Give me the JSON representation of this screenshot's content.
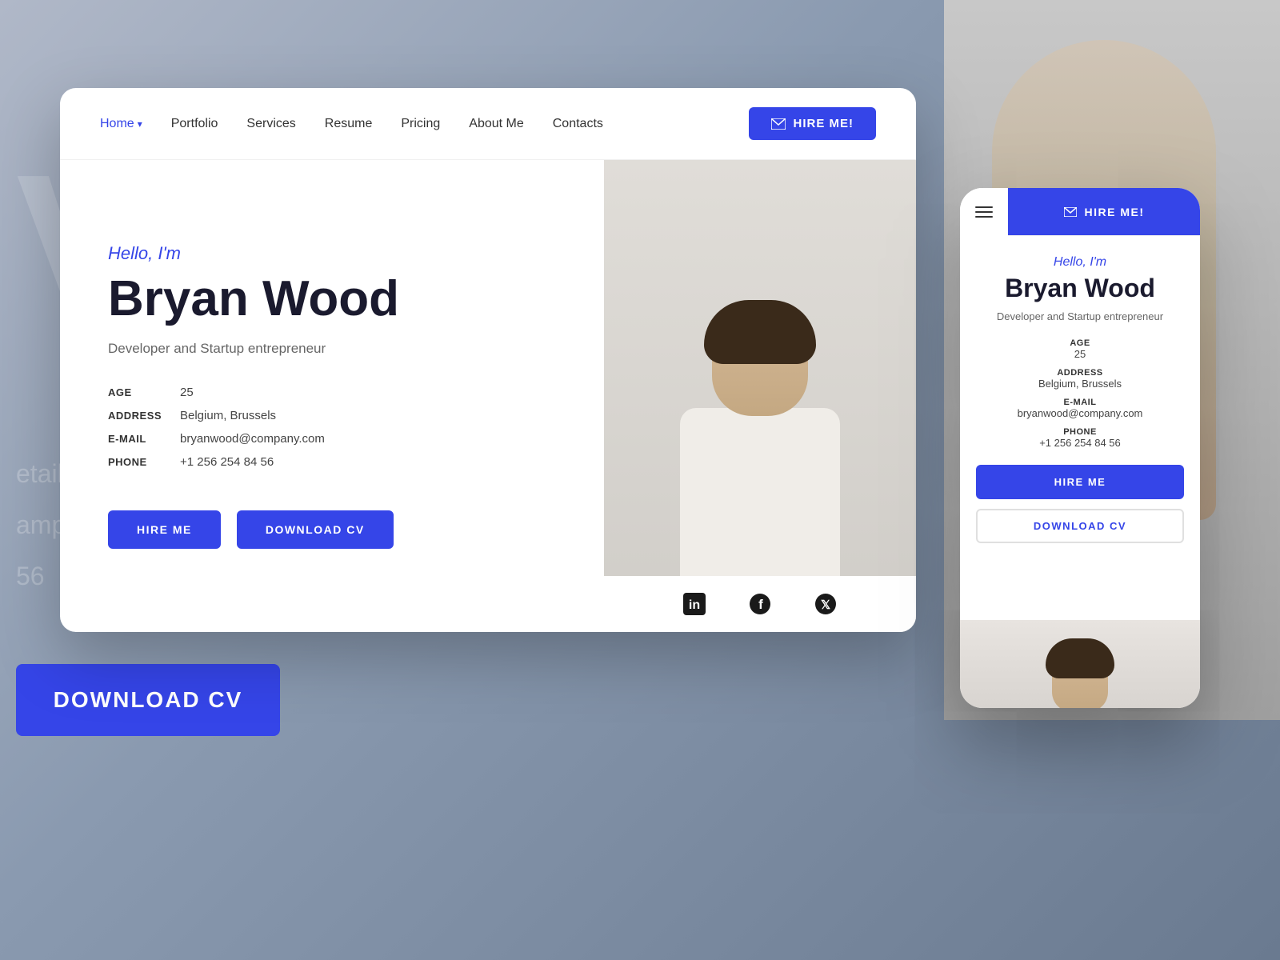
{
  "background": {
    "letter": "V",
    "lines": [
      "etails",
      "ampus",
      "56"
    ]
  },
  "nav": {
    "links": [
      {
        "label": "Home",
        "active": true
      },
      {
        "label": "Portfolio",
        "active": false
      },
      {
        "label": "Services",
        "active": false
      },
      {
        "label": "Resume",
        "active": false
      },
      {
        "label": "Pricing",
        "active": false
      },
      {
        "label": "About Me",
        "active": false
      },
      {
        "label": "Contacts",
        "active": false
      }
    ],
    "hire_button": "HIRE ME!"
  },
  "profile": {
    "greeting": "Hello, I'm",
    "name": "Bryan Wood",
    "subtitle": "Developer and Startup entrepreneur",
    "info": {
      "age_label": "AGE",
      "age_value": "25",
      "address_label": "ADDRESS",
      "address_value": "Belgium, Brussels",
      "email_label": "E-MAIL",
      "email_value": "bryanwood@company.com",
      "phone_label": "PHONE",
      "phone_value": "+1 256 254 84 56"
    },
    "hire_me_btn": "HIRE ME",
    "download_cv_btn": "DOWNLOAD CV"
  },
  "social": {
    "linkedin": "in",
    "facebook": "f",
    "twitter": "t"
  },
  "mobile": {
    "hire_button": "HIRE ME!",
    "greeting": "Hello, I'm",
    "name": "Bryan Wood",
    "subtitle": "Developer and Startup entrepreneur",
    "info": {
      "age_label": "AGE",
      "age_value": "25",
      "address_label": "ADDRESS",
      "address_value": "Belgium, Brussels",
      "email_label": "E-MAIL",
      "email_value": "bryanwood@company.com",
      "phone_label": "PHONE",
      "phone_value": "+1 256 254 84 56"
    },
    "hire_me_btn": "HIRE ME",
    "download_cv_btn": "DOWNLOAD CV"
  },
  "colors": {
    "accent": "#3545e8",
    "text_dark": "#1a1a2e",
    "text_gray": "#666"
  }
}
